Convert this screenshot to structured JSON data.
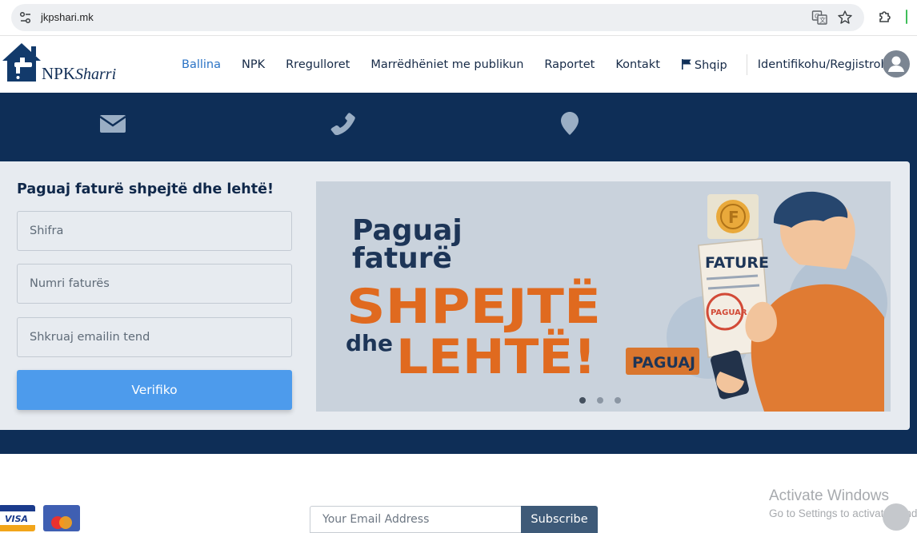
{
  "browser": {
    "url": "jkpshari.mk"
  },
  "logo": {
    "text_main": "NPK",
    "text_script": "Sharri"
  },
  "nav": {
    "items": [
      {
        "label": "Ballina",
        "active": true
      },
      {
        "label": "NPK"
      },
      {
        "label": "Rregulloret"
      },
      {
        "label": "Marrëdhëniet me publikun"
      },
      {
        "label": "Raportet"
      },
      {
        "label": "Kontakt"
      }
    ],
    "language": "Shqip",
    "login": "Identifikohu/Regjistrohu"
  },
  "contact_icons": [
    "envelope-icon",
    "phone-icon",
    "map-marker-icon"
  ],
  "payment_form": {
    "title": "Paguaj faturë shpejtë dhe lehtë!",
    "code_placeholder": "Shifra",
    "invoice_placeholder": "Numri faturës",
    "email_placeholder": "Shkruaj emailin tend",
    "verify_label": "Verifiko"
  },
  "banner": {
    "line1": "Paguaj",
    "line2": "faturë",
    "line3": "SHPEJTË",
    "line4_small": "dhe",
    "line4_big": "LEHTË!",
    "invoice_label": "FATURE",
    "stamp_label": "PAGUAR",
    "coin_label": "F",
    "pay_tag": "PAGUAJ",
    "slides_count": 3,
    "active_slide": 1
  },
  "footer": {
    "card_logos": [
      "VISA",
      "mastercard"
    ],
    "email_placeholder": "Your Email Address",
    "subscribe_label": "Subscribe"
  },
  "watermark": {
    "title": "Activate Windows",
    "subtitle": "Go to Settings to activate Windows."
  },
  "colors": {
    "navy": "#0e2e57",
    "accent_blue": "#4d9bec",
    "banner_orange": "#e06a1f"
  }
}
